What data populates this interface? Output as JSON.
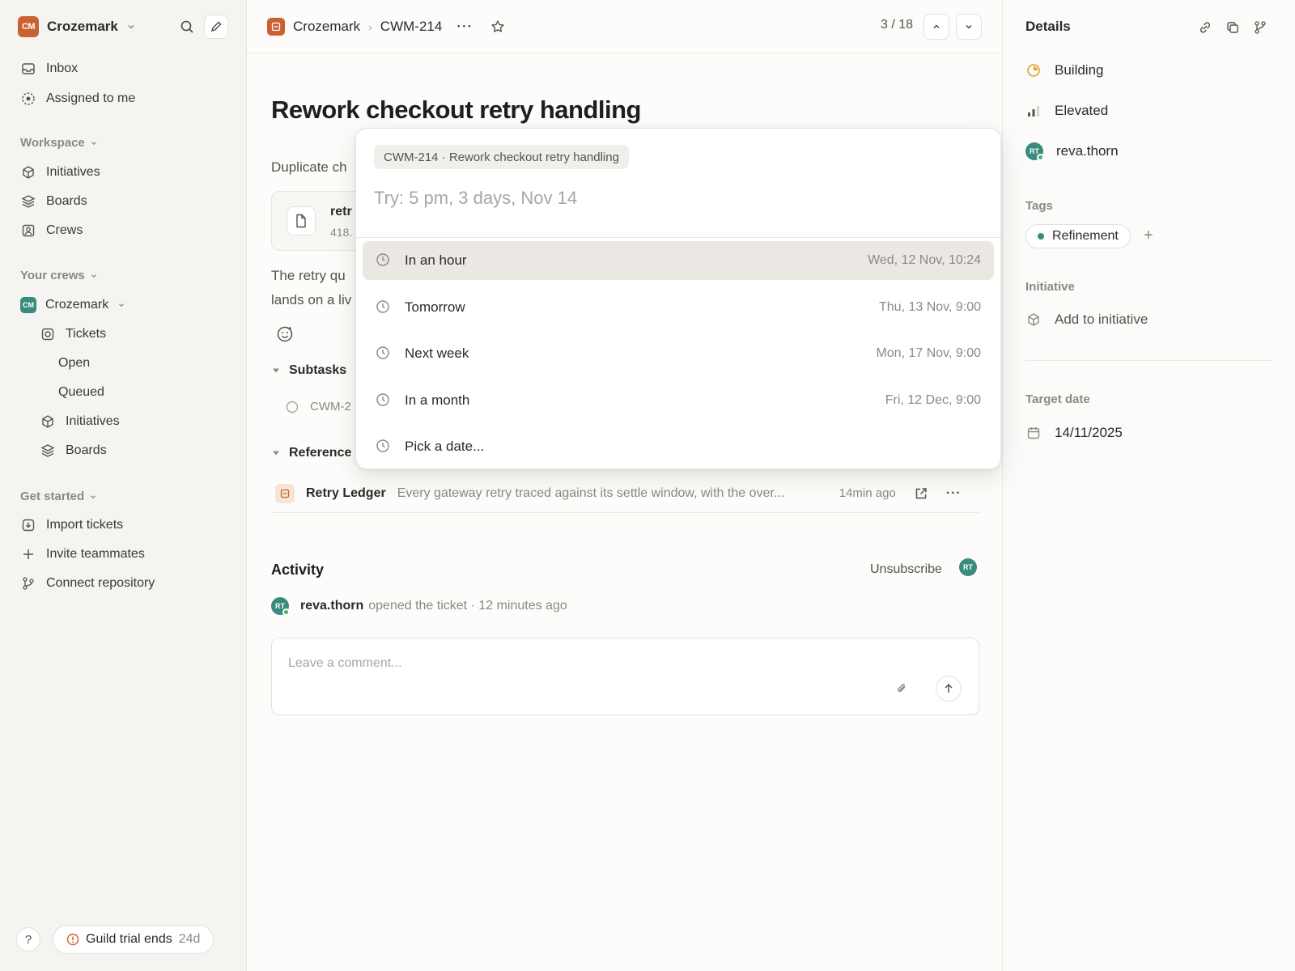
{
  "sidebar": {
    "workspace": {
      "logo": "CM",
      "name": "Crozemark"
    },
    "top_items": [
      {
        "label": "Inbox",
        "icon": "inbox-icon"
      },
      {
        "label": "Assigned to me",
        "icon": "assigned-icon"
      }
    ],
    "workspace_section": {
      "label": "Workspace",
      "items": [
        {
          "label": "Initiatives",
          "icon": "cube-icon"
        },
        {
          "label": "Boards",
          "icon": "layers-icon"
        },
        {
          "label": "Crews",
          "icon": "crews-icon"
        }
      ]
    },
    "crews_section": {
      "label": "Your crews",
      "crew": {
        "logo": "CM",
        "name": "Crozemark"
      },
      "items": [
        {
          "label": "Tickets",
          "icon": "tickets-icon"
        },
        {
          "label": "Open"
        },
        {
          "label": "Queued"
        },
        {
          "label": "Initiatives",
          "icon": "cube-icon"
        },
        {
          "label": "Boards",
          "icon": "layers-icon"
        }
      ]
    },
    "get_started": {
      "label": "Get started",
      "items": [
        {
          "label": "Import tickets",
          "icon": "import-icon"
        },
        {
          "label": "Invite teammates",
          "icon": "plus-icon"
        },
        {
          "label": "Connect repository",
          "icon": "branch-icon"
        }
      ]
    },
    "help": "?",
    "trial": {
      "text": "Guild trial ends",
      "days": "24d"
    }
  },
  "topbar": {
    "crumb_team": "Crozemark",
    "crumb_ticket": "CWM-214",
    "more": "···",
    "pager": "3 / 18"
  },
  "ticket": {
    "title": "Rework checkout retry handling",
    "desc_line1": "Duplicate ch",
    "attachment": {
      "name": "retr",
      "size": "418."
    },
    "body_line1": "The retry qu",
    "body_line2": "lands on a liv",
    "subtasks_label": "Subtasks",
    "subtask_id": "CWM-2",
    "references_label": "Reference",
    "reference": {
      "name": "Retry Ledger",
      "desc": "Every gateway retry traced against its settle window, with the over...",
      "time": "14min ago"
    }
  },
  "activity": {
    "title": "Activity",
    "unsubscribe": "Unsubscribe",
    "avatar": "RT",
    "entry": {
      "who": "reva.thorn",
      "what": "opened the ticket · 12 minutes ago"
    },
    "comment_placeholder": "Leave a comment..."
  },
  "details": {
    "title": "Details",
    "status": "Building",
    "priority": "Elevated",
    "assignee": {
      "initials": "RT",
      "name": "reva.thorn"
    },
    "tags_label": "Tags",
    "tag": "Refinement",
    "tag_add": "+",
    "initiative_label": "Initiative",
    "initiative_action": "Add to initiative",
    "target_label": "Target date",
    "target_date": "14/11/2025"
  },
  "popover": {
    "chip": "CWM-214 · Rework checkout retry handling",
    "placeholder": "Try: 5 pm, 3 days, Nov 14",
    "options": [
      {
        "label": "In an hour",
        "date": "Wed, 12 Nov, 10:24"
      },
      {
        "label": "Tomorrow",
        "date": "Thu, 13 Nov, 9:00"
      },
      {
        "label": "Next week",
        "date": "Mon, 17 Nov, 9:00"
      },
      {
        "label": "In a month",
        "date": "Fri, 12 Dec, 9:00"
      },
      {
        "label": "Pick a date...",
        "date": ""
      }
    ]
  },
  "colors": {
    "brand": "#c9622e",
    "crew": "#3b8a7e",
    "status_building": "#e0a230",
    "active_option": "#ebe8e3"
  }
}
